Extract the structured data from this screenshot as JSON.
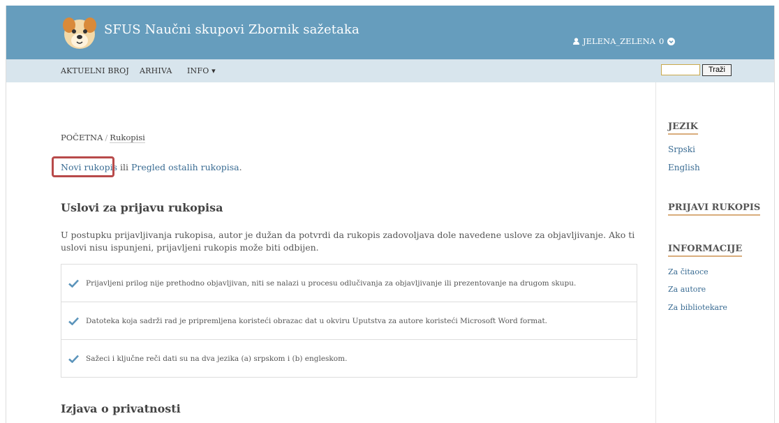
{
  "header": {
    "site_title": "SFUS Naučni skupovi Zbornik sažetaka",
    "user_name": "JELENA_ZELENA",
    "notification_count": "0",
    "background_color": "#669dbd"
  },
  "nav": {
    "items": [
      {
        "label": "AKTUELNI BROJ"
      },
      {
        "label": "ARHIVA"
      },
      {
        "label": "INFO"
      }
    ],
    "info_caret": "▾",
    "search_button": "Traži",
    "search_value": ""
  },
  "breadcrumb": {
    "home": "POČETNA",
    "separator": "/",
    "current": "Rukopisi"
  },
  "intro": {
    "new_link": "Novi rukopis",
    "middle_text": " ili ",
    "review_link": "Pregled ostalih rukopisa",
    "end": "."
  },
  "conditions": {
    "title": "Uslovi za prijavu rukopisa",
    "description": "U postupku prijavljivanja rukopisa, autor je dužan da potvrdi da rukopis zadovoljava dole navedene uslove za objavljivanje. Ako ti uslovi nisu ispunjeni, prijavljeni rukopis može biti odbijen.",
    "items": [
      {
        "text": "Prijavljeni prilog nije prethodno objavljivan, niti se nalazi u procesu odlučivanja za objavljivanje ili prezentovanje na drugom skupu."
      },
      {
        "text": "Datoteka koja sadrži rad je pripremljena koristeći obrazac dat u okviru Uputstva za autore koristeći Microsoft Word format."
      },
      {
        "text": "Sažeci i ključne reči dati su na dva jezika (a) srpskom i (b) engleskom."
      }
    ]
  },
  "privacy": {
    "title": "Izjava o privatnosti"
  },
  "sidebar": {
    "language_heading": "JEZIK",
    "languages": [
      {
        "label": "Srpski"
      },
      {
        "label": "English"
      }
    ],
    "submit_heading": "PRIJAVI RUKOPIS",
    "info_heading": "INFORMACIJE",
    "info_links": [
      {
        "label": "Za čitaoce"
      },
      {
        "label": "Za autore"
      },
      {
        "label": "Za bibliotekare"
      }
    ]
  },
  "colors": {
    "accent_link": "#3a6c93",
    "highlight": "#b84a4a",
    "check": "#5b94bb"
  }
}
